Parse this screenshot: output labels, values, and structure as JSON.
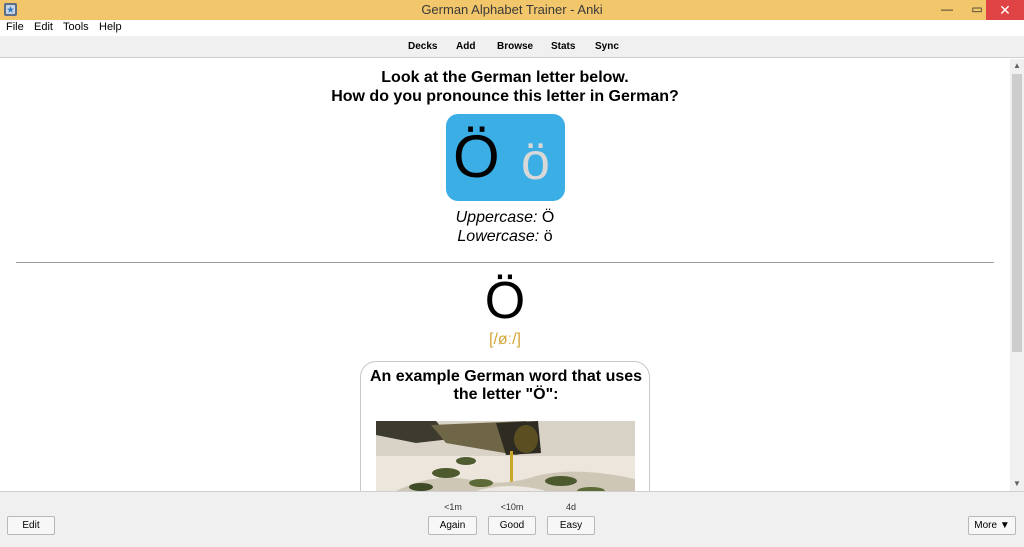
{
  "window": {
    "title": "German Alphabet Trainer - Anki",
    "minimize_glyph": "—",
    "maximize_glyph": "▭",
    "close_glyph": "✕"
  },
  "menu": [
    "File",
    "Edit",
    "Tools",
    "Help"
  ],
  "toolbar": [
    "Decks",
    "Add",
    "Browse",
    "Stats",
    "Sync"
  ],
  "card": {
    "question_line1": "Look at the German letter below.",
    "question_line2": "How do you pronounce this letter in German?",
    "letter_upper": "Ö",
    "letter_lower": "ö",
    "uppercase_label": "Uppercase:",
    "uppercase_value": "Ö",
    "lowercase_label": "Lowercase:",
    "lowercase_value": "ö",
    "answer_letter": "Ö",
    "ipa": "[/øː/]",
    "example_line1": "An example German word that uses",
    "example_line2": "the letter \"Ö\":"
  },
  "bottom": {
    "edit_label": "Edit",
    "more_label": "More ▼",
    "answers": [
      {
        "interval": "<1m",
        "label": "Again"
      },
      {
        "interval": "<10m",
        "label": "Good"
      },
      {
        "interval": "4d",
        "label": "Easy"
      }
    ]
  },
  "scrollbar": {
    "up_glyph": "▲",
    "down_glyph": "▼"
  },
  "colors": {
    "titlebar": "#f2c66a",
    "letter_box": "#3baee5",
    "ipa": "#d4a537",
    "close_button": "#e04343"
  }
}
